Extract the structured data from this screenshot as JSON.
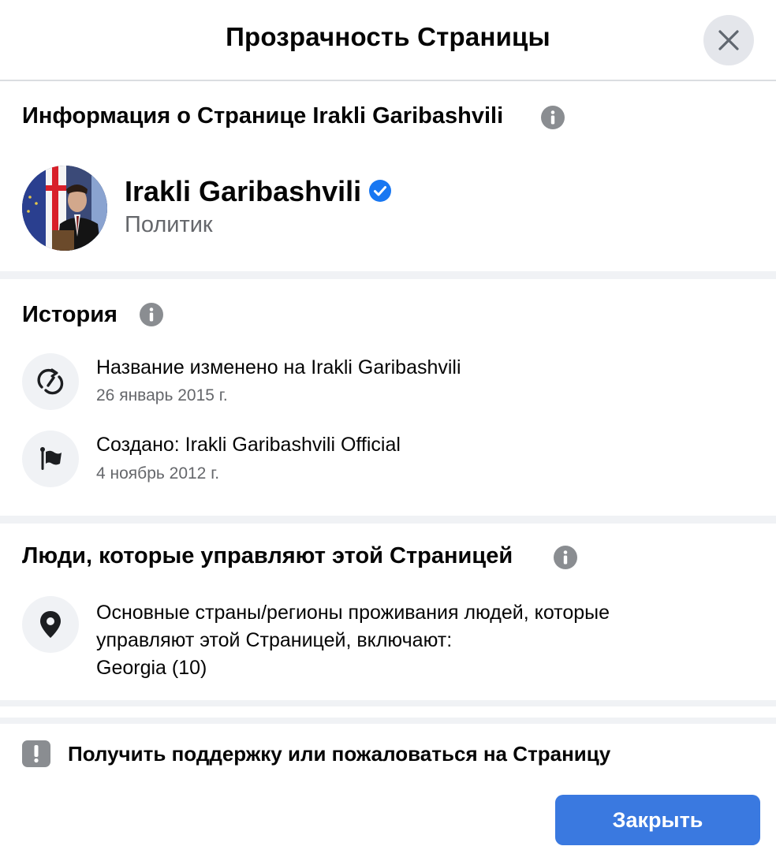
{
  "dialog": {
    "title": "Прозрачность Страницы",
    "close_icon": "close-icon"
  },
  "page_info": {
    "section_title": "Информация о Странице Irakli Garibashvili",
    "info_icon": "info-icon",
    "name": "Irakli Garibashvili",
    "verified_icon": "verified-badge-icon",
    "category": "Политик"
  },
  "history": {
    "section_title": "История",
    "info_icon": "info-icon",
    "items": [
      {
        "icon": "rename-icon",
        "label": "Название изменено на Irakli Garibashvili",
        "date": "26 январь 2015 г."
      },
      {
        "icon": "flag-icon",
        "label": "Создано: Irakli Garibashvili Official",
        "date": "4 ноябрь 2012 г."
      }
    ]
  },
  "managers": {
    "section_title": "Люди, которые управляют этой Страницей",
    "info_icon": "info-icon",
    "location_icon": "location-pin-icon",
    "line1": "Основные страны/регионы проживания людей, которые",
    "line2": "управляют этой Страницей, включают:",
    "line3": "Georgia (10)"
  },
  "footer": {
    "support_icon": "alert-icon",
    "support_label": "Получить поддержку или пожаловаться на Страницу",
    "close_button": "Закрыть"
  },
  "colors": {
    "accent": "#3a79e0",
    "verified": "#1877f2",
    "secondary_text": "#65676b",
    "separator": "#f0f2f5"
  }
}
